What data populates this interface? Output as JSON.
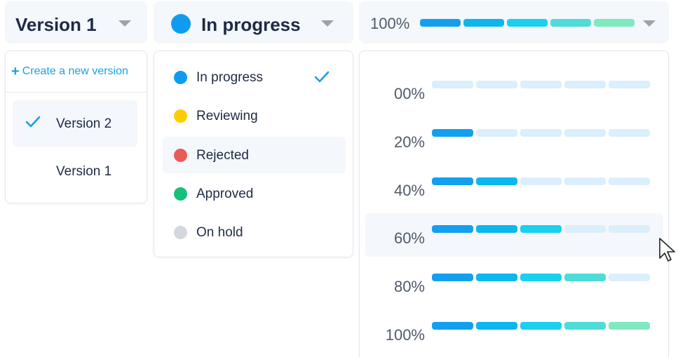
{
  "colors": {
    "accent": "#1aa0e6",
    "inactive_segment": "#dbeefc",
    "header_bg": "#f4f7fb",
    "hover_bg": "#f4f7fb",
    "segments": [
      "#139ff0",
      "#0cb6ee",
      "#19d0f0",
      "#4ddcd8",
      "#7fe9bf"
    ]
  },
  "version": {
    "selected_label": "Version 1",
    "menu": {
      "create_label": "Create a new version",
      "items": [
        {
          "label": "Version 2",
          "checked": true,
          "hovered": true
        },
        {
          "label": "Version 1",
          "checked": false,
          "hovered": false
        }
      ]
    }
  },
  "status": {
    "selected_label": "In progress",
    "selected_color": "#0f9cf0",
    "menu": {
      "items": [
        {
          "label": "In progress",
          "color": "#0f9cf0",
          "checked": true,
          "hovered": false
        },
        {
          "label": "Reviewing",
          "color": "#ffcc00",
          "checked": false,
          "hovered": false
        },
        {
          "label": "Rejected",
          "color": "#e85c55",
          "checked": false,
          "hovered": true
        },
        {
          "label": "Approved",
          "color": "#17c07a",
          "checked": false,
          "hovered": false
        },
        {
          "label": "On hold",
          "color": "#d3d7de",
          "checked": false,
          "hovered": false
        }
      ]
    }
  },
  "progress": {
    "selected_label": "100%",
    "selected_value": 100,
    "menu": {
      "items": [
        {
          "label": "00%",
          "value": 0,
          "hovered": false
        },
        {
          "label": "20%",
          "value": 20,
          "hovered": false
        },
        {
          "label": "40%",
          "value": 40,
          "hovered": false
        },
        {
          "label": "60%",
          "value": 60,
          "hovered": true
        },
        {
          "label": "80%",
          "value": 80,
          "hovered": false
        },
        {
          "label": "100%",
          "value": 100,
          "hovered": false
        }
      ]
    }
  }
}
